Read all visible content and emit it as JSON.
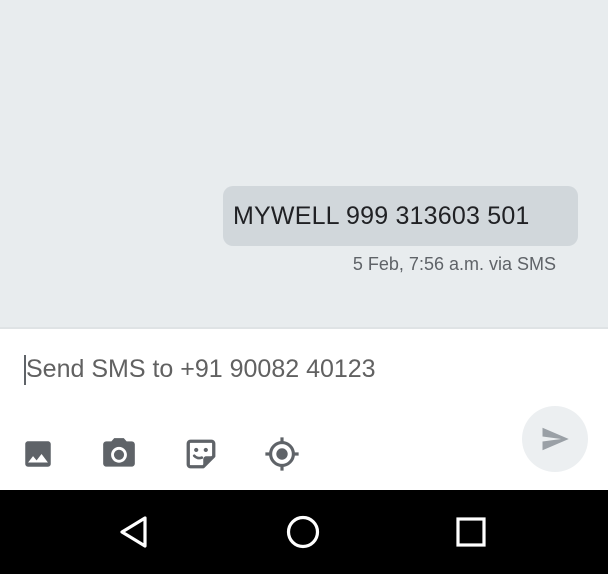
{
  "conversation": {
    "messages": [
      {
        "text": "MYWELL 999 313603 501",
        "meta": "5 Feb, 7:56 a.m. via SMS",
        "direction": "outgoing"
      }
    ]
  },
  "composer": {
    "placeholder": "Send SMS to +91 90082 40123",
    "value": "",
    "attachments": [
      {
        "icon": "image-icon"
      },
      {
        "icon": "camera-icon"
      },
      {
        "icon": "sticker-icon"
      },
      {
        "icon": "location-icon"
      }
    ],
    "send_icon": "send-icon"
  },
  "navigation_bar": {
    "buttons": [
      {
        "icon": "back-icon"
      },
      {
        "icon": "home-icon"
      },
      {
        "icon": "recents-icon"
      }
    ]
  },
  "colors": {
    "conversation_bg": "#e8ecee",
    "bubble_bg": "#d1d7db",
    "icon_gray": "#5f6368",
    "send_button_bg": "#eceff1",
    "navbar_bg": "#000000"
  }
}
